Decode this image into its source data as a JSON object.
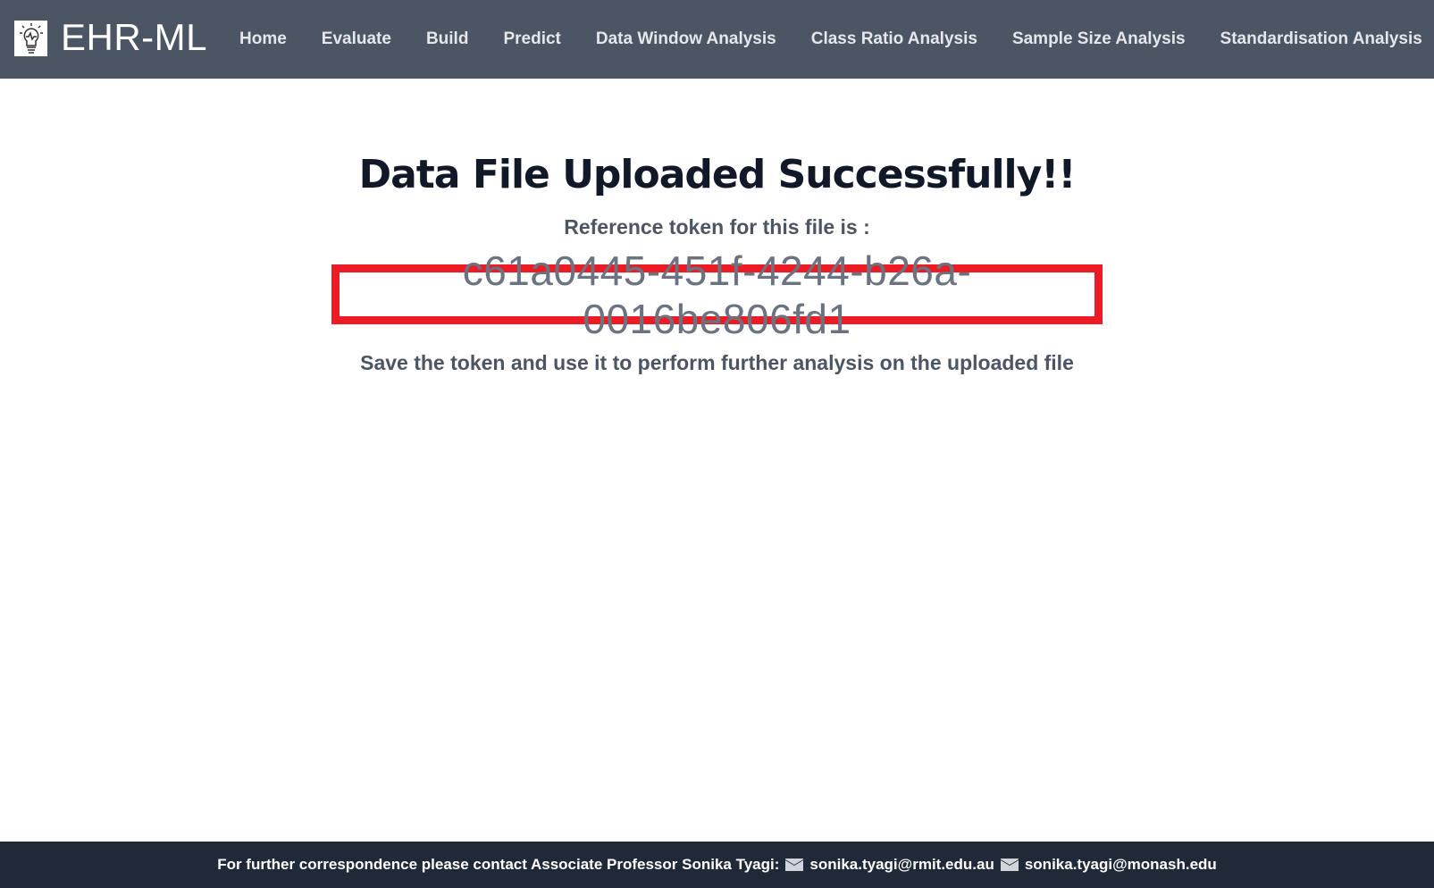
{
  "header": {
    "brand": "EHR-ML",
    "logo_icon": "lightbulb-heartbeat-icon",
    "nav": [
      "Home",
      "Evaluate",
      "Build",
      "Predict",
      "Data Window Analysis",
      "Class Ratio Analysis",
      "Sample Size Analysis",
      "Standardisation Analysis"
    ]
  },
  "main": {
    "title": "Data File Uploaded Successfully!!",
    "reference_label": "Reference token for this file is :",
    "token": "c61a0445-451f-4244-b26a-0016be806fd1",
    "instruction": "Save the token and use it to perform further analysis on the uploaded file",
    "token_border_color": "#ed1c24"
  },
  "footer": {
    "text": "For further correspondence please contact Associate Professor Sonika Tyagi:",
    "email_icon": "envelope-icon",
    "emails": [
      "sonika.tyagi@rmit.edu.au",
      "sonika.tyagi@monash.edu"
    ]
  }
}
